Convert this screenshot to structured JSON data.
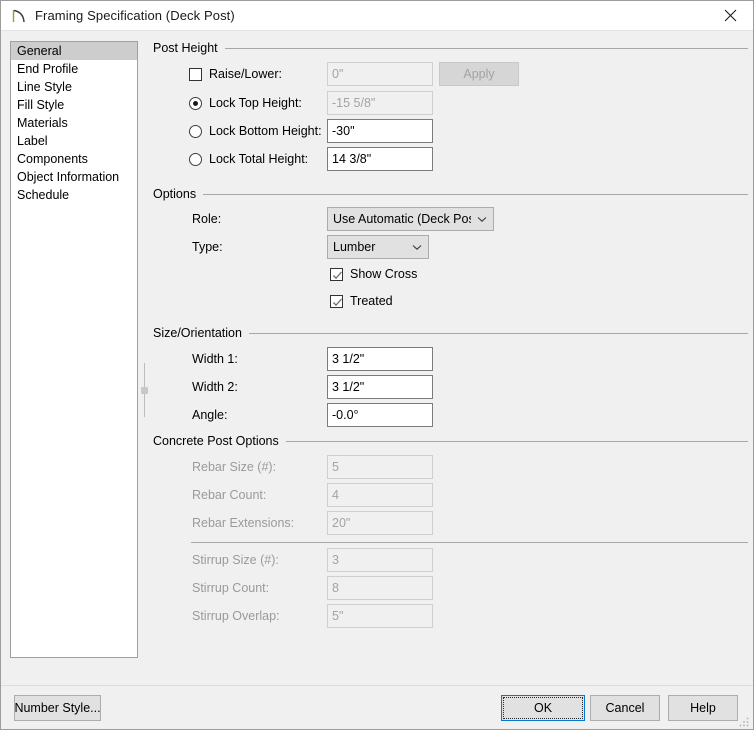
{
  "window": {
    "title": "Framing Specification (Deck Post)",
    "icon": "framing-arc-icon",
    "close_label": "✕"
  },
  "sidebar": {
    "items": [
      {
        "label": "General",
        "selected": true
      },
      {
        "label": "End Profile",
        "selected": false
      },
      {
        "label": "Line Style",
        "selected": false
      },
      {
        "label": "Fill Style",
        "selected": false
      },
      {
        "label": "Materials",
        "selected": false
      },
      {
        "label": "Label",
        "selected": false
      },
      {
        "label": "Components",
        "selected": false
      },
      {
        "label": "Object Information",
        "selected": false
      },
      {
        "label": "Schedule",
        "selected": false
      }
    ]
  },
  "post_height": {
    "group_title": "Post Height",
    "raise_lower": {
      "label": "Raise/Lower:",
      "checked": false,
      "value": "0\"",
      "enabled": false
    },
    "apply_button": {
      "label": "Apply",
      "enabled": false
    },
    "lock_top": {
      "label": "Lock Top Height:",
      "selected": true,
      "value": "-15 5/8\"",
      "enabled": false
    },
    "lock_bottom": {
      "label": "Lock Bottom Height:",
      "selected": false,
      "value": "-30\"",
      "enabled": true
    },
    "lock_total": {
      "label": "Lock Total Height:",
      "selected": false,
      "value": "14 3/8\"",
      "enabled": true
    }
  },
  "options": {
    "group_title": "Options",
    "role": {
      "label": "Role:",
      "value": "Use Automatic (Deck Post)"
    },
    "type": {
      "label": "Type:",
      "value": "Lumber"
    },
    "show_cross": {
      "label": "Show Cross",
      "checked": true
    },
    "treated": {
      "label": "Treated",
      "checked": true
    }
  },
  "size_orientation": {
    "group_title": "Size/Orientation",
    "width1": {
      "label": "Width 1:",
      "value": "3 1/2\""
    },
    "width2": {
      "label": "Width 2:",
      "value": "3 1/2\""
    },
    "angle": {
      "label": "Angle:",
      "value": "-0.0°"
    }
  },
  "concrete_post_options": {
    "group_title": "Concrete Post Options",
    "rebar_size": {
      "label": "Rebar Size (#):",
      "value": "5",
      "enabled": false
    },
    "rebar_count": {
      "label": "Rebar Count:",
      "value": "4",
      "enabled": false
    },
    "rebar_extensions": {
      "label": "Rebar Extensions:",
      "value": "20\"",
      "enabled": false
    },
    "stirrup_size": {
      "label": "Stirrup Size (#):",
      "value": "3",
      "enabled": false
    },
    "stirrup_count": {
      "label": "Stirrup Count:",
      "value": "8",
      "enabled": false
    },
    "stirrup_overlap": {
      "label": "Stirrup Overlap:",
      "value": "5\"",
      "enabled": false
    }
  },
  "footer": {
    "number_style": "Number Style...",
    "ok": "OK",
    "cancel": "Cancel",
    "help": "Help"
  },
  "colors": {
    "dialog_bg": "#f0f0f0",
    "titlebar_bg": "#ffffff",
    "accent_focus": "#0078d7",
    "selection_bg": "#cdcdcd",
    "disabled_text": "#a3a3a3",
    "icon_green": "#7ab317"
  }
}
